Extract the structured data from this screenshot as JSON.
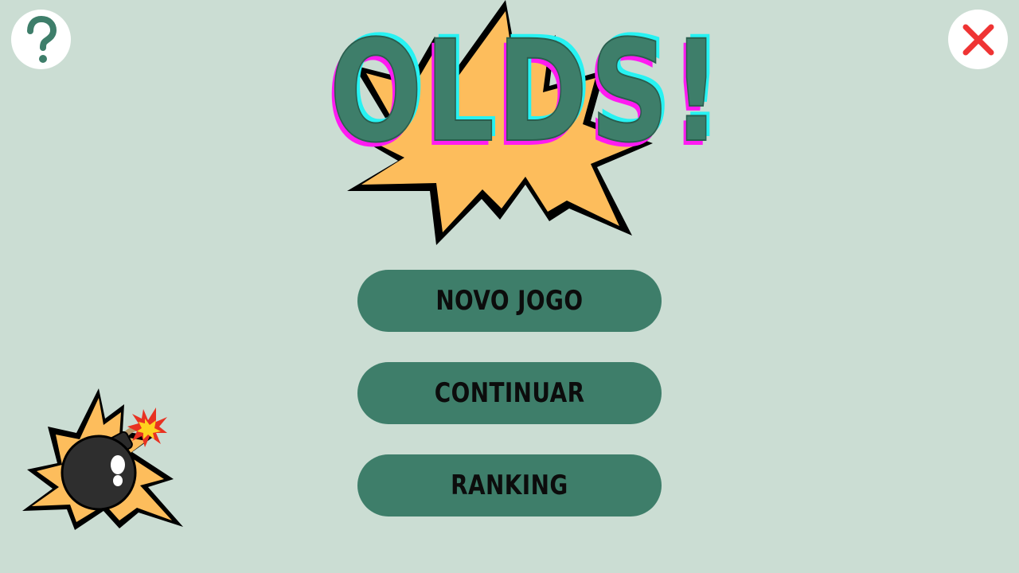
{
  "game": {
    "title": "OLDS!"
  },
  "header": {
    "help_icon": "question-mark-icon",
    "close_icon": "close-x-icon"
  },
  "menu": {
    "new_game_label": "NOVO JOGO",
    "continue_label": "CONTINUAR",
    "ranking_label": "RANKING"
  },
  "colors": {
    "background": "#cbddd3",
    "primary": "#3e7e6a",
    "burst": "#fdbd5c",
    "title_shadow_cyan": "#27f2f2",
    "title_shadow_magenta": "#ff1bf1",
    "close_red": "#ef3434"
  },
  "decoration": {
    "icon": "bomb-explosion-icon"
  }
}
